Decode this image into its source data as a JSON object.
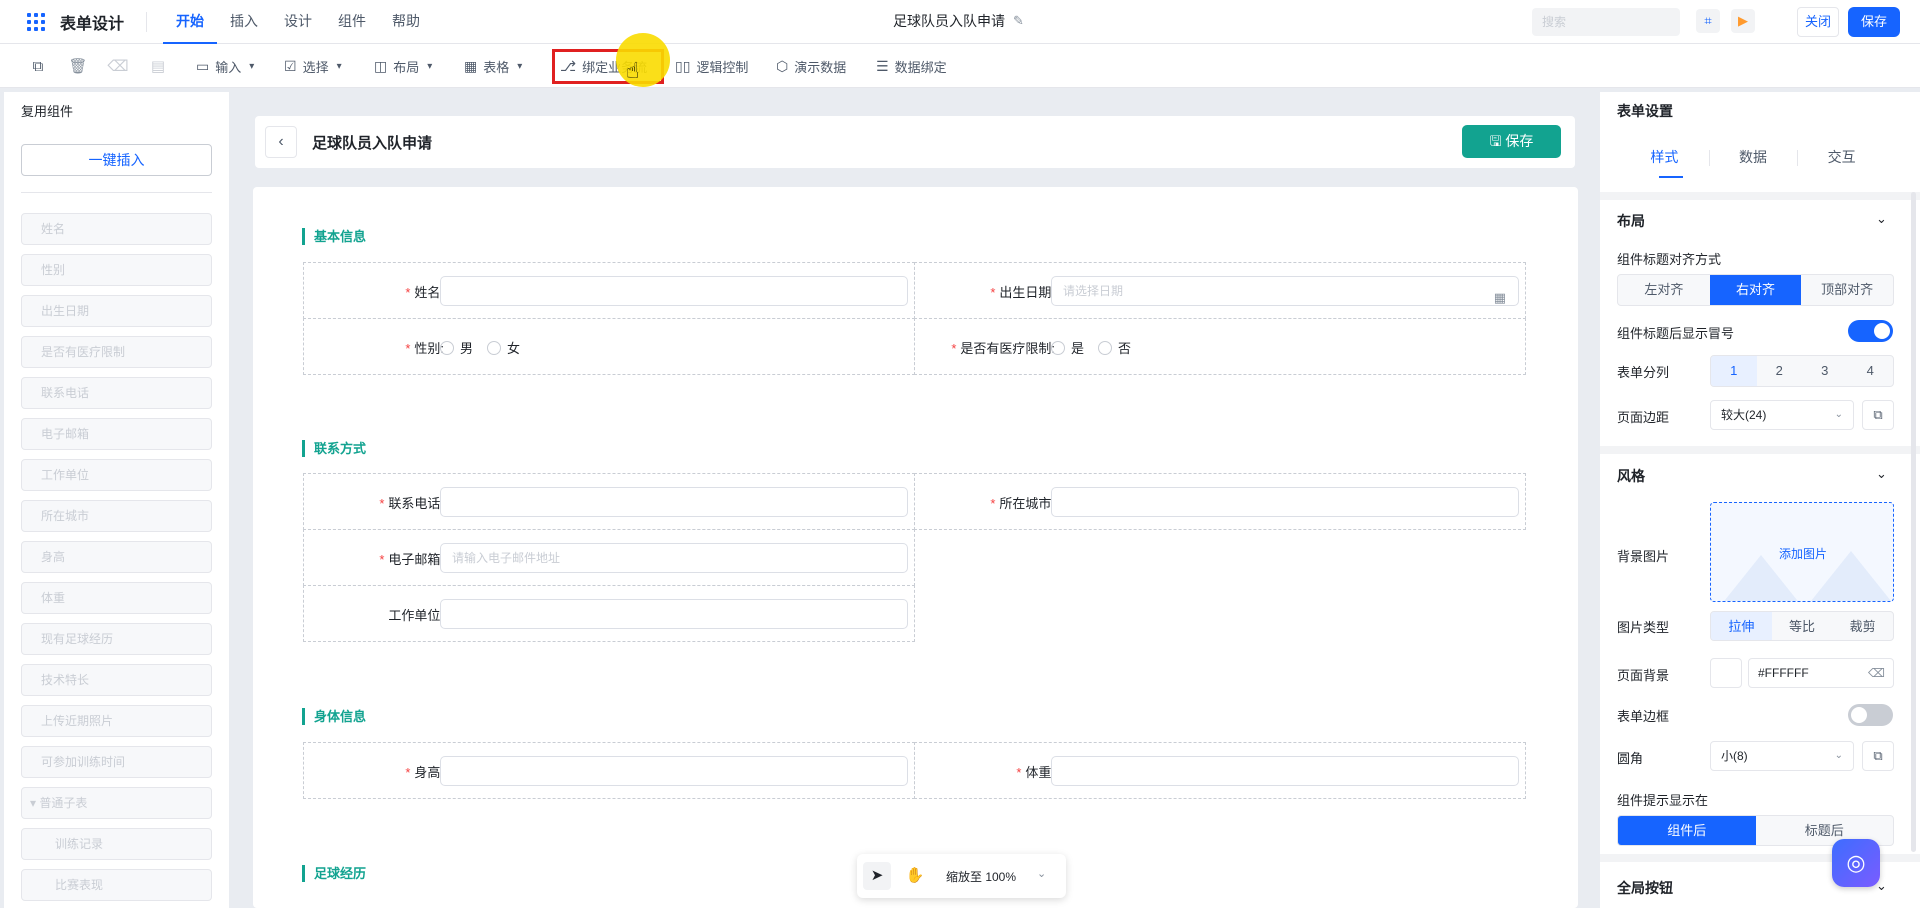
{
  "topbar": {
    "app_title": "表单设计",
    "menu_tabs": [
      "开始",
      "插入",
      "设计",
      "组件",
      "帮助"
    ],
    "doc_title": "足球队员入队申请",
    "search_placeholder": "搜索",
    "close_label": "关闭",
    "save_label": "保存"
  },
  "toolbar": {
    "input_label": "输入",
    "select_label": "选择",
    "layout_label": "布局",
    "table_label": "表格",
    "bind_process_label": "绑定业务流",
    "logic_label": "逻辑控制",
    "demo_label": "演示数据",
    "data_bind_label": "数据绑定"
  },
  "left_panel": {
    "title": "复用组件",
    "insert_all": "一键插入",
    "items": [
      "姓名",
      "性别",
      "出生日期",
      "是否有医疗限制",
      "联系电话",
      "电子邮箱",
      "工作单位",
      "所在城市",
      "身高",
      "体重",
      "现有足球经历",
      "技术特长",
      "上传近期照片",
      "可参加训练时间"
    ],
    "group_label": "普通子表",
    "sub_items": [
      "训练记录",
      "比赛表现"
    ]
  },
  "canvas": {
    "title": "足球队员入队申请",
    "save_label": "保存",
    "sections": {
      "basic": "基本信息",
      "contact": "联系方式",
      "body": "身体信息",
      "football": "足球经历"
    },
    "fields": {
      "name": "姓名:",
      "birth": "出生日期:",
      "birth_placeholder": "请选择日期",
      "gender": "性别:",
      "gender_male": "男",
      "gender_female": "女",
      "medical": "是否有医疗限制:",
      "medical_yes": "是",
      "medical_no": "否",
      "phone": "联系电话:",
      "city": "所在城市:",
      "email": "电子邮箱:",
      "email_placeholder": "请输入电子邮件地址",
      "work": "工作单位:",
      "height": "身高:",
      "weight": "体重:"
    },
    "required_mark": "*"
  },
  "zoom": {
    "label": "缩放至 100%"
  },
  "right_panel": {
    "title": "表单设置",
    "tabs": [
      "样式",
      "数据",
      "交互"
    ],
    "layout_section": "布局",
    "label_align_title": "组件标题对齐方式",
    "align_options": [
      "左对齐",
      "右对齐",
      "顶部对齐"
    ],
    "colon_label": "组件标题后显示冒号",
    "columns_label": "表单分列",
    "columns_options": [
      "1",
      "2",
      "3",
      "4"
    ],
    "margin_label": "页面边距",
    "margin_value": "较大(24)",
    "style_section": "风格",
    "bg_image_label": "背景图片",
    "add_image": "添加图片",
    "image_type_label": "图片类型",
    "image_type_options": [
      "拉伸",
      "等比",
      "裁剪"
    ],
    "page_bg_label": "页面背景",
    "page_bg_value": "#FFFFFF",
    "border_label": "表单边框",
    "radius_label": "圆角",
    "radius_value": "小(8)",
    "tip_label": "组件提示显示在",
    "tip_options": [
      "组件后",
      "标题后"
    ],
    "global_buttons": "全局按钮"
  },
  "colors": {
    "primary": "#1664ff",
    "teal": "#12a390",
    "required": "#f53f3f"
  }
}
